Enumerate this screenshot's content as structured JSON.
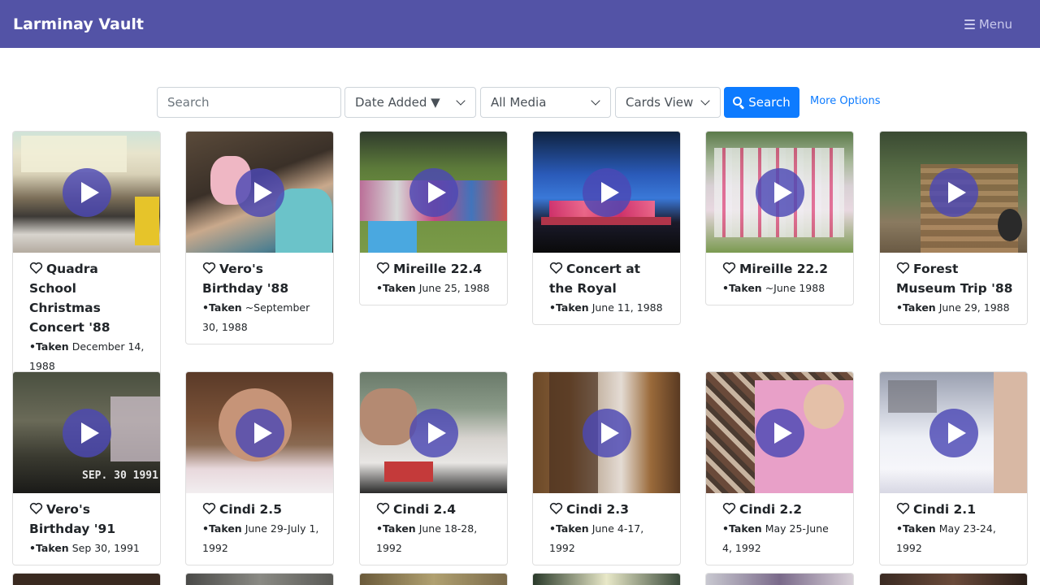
{
  "app": {
    "title": "Larminay Vault",
    "menu_label": "Menu"
  },
  "toolbar": {
    "search_placeholder": "Search",
    "sort_value": "Date Added ▼",
    "media_value": "All Media",
    "view_value": "Cards View",
    "search_button": "Search",
    "more_options": "More Options"
  },
  "labels": {
    "taken": "•Taken"
  },
  "colors": {
    "navbar": "#5353a6",
    "accent": "#0d7bff",
    "play_button": "#4c48b4"
  },
  "cards": [
    {
      "title": "Quadra School Christmas Concert '88",
      "taken": "December 14, 1988"
    },
    {
      "title": "Vero's Birthday '88",
      "taken": "~September 30, 1988"
    },
    {
      "title": "Mireille 22.4",
      "taken": "June 25, 1988"
    },
    {
      "title": "Concert at the Royal",
      "taken": "June 11, 1988"
    },
    {
      "title": "Mireille 22.2",
      "taken": "~June 1988"
    },
    {
      "title": "Forest Museum Trip '88",
      "taken": "June 29, 1988"
    },
    {
      "title": "Vero's Birthday '91",
      "taken": "Sep 30, 1991",
      "overlay": "SEP. 30 1991"
    },
    {
      "title": "Cindi 2.5",
      "taken": "June 29-July 1, 1992"
    },
    {
      "title": "Cindi 2.4",
      "taken": "June 18-28, 1992"
    },
    {
      "title": "Cindi 2.3",
      "taken": "June 4-17, 1992"
    },
    {
      "title": "Cindi 2.2",
      "taken": "May 25-June 4, 1992"
    },
    {
      "title": "Cindi 2.1",
      "taken": "May 23-24, 1992"
    }
  ]
}
